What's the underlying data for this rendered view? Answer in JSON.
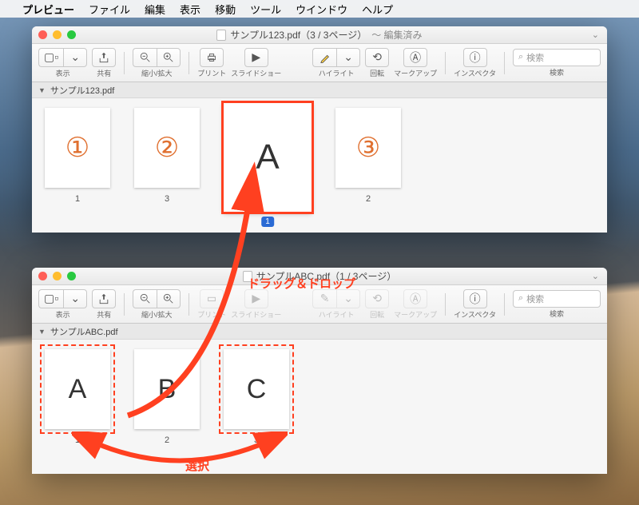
{
  "menubar": {
    "apple": "",
    "app": "プレビュー",
    "items": [
      "ファイル",
      "編集",
      "表示",
      "移動",
      "ツール",
      "ウインドウ",
      "ヘルプ"
    ]
  },
  "window1": {
    "title": "サンプル123.pdf（3 / 3ページ）",
    "status": "〜 編集済み",
    "sidebar": "サンプル123.pdf",
    "thumbs": [
      {
        "glyph": "①",
        "label": "1",
        "kind": "circled"
      },
      {
        "glyph": "②",
        "label": "3",
        "kind": "circled"
      },
      {
        "glyph": "A",
        "label": "",
        "kind": "big",
        "badge": "1"
      },
      {
        "glyph": "③",
        "label": "2",
        "kind": "circled"
      }
    ]
  },
  "window2": {
    "title": "サンプルABC.pdf（1 / 3ページ）",
    "sidebar": "サンプルABC.pdf",
    "thumbs": [
      {
        "glyph": "A",
        "label": "1",
        "kind": "letter",
        "selected": true
      },
      {
        "glyph": "B",
        "label": "2",
        "kind": "letter"
      },
      {
        "glyph": "C",
        "label": "3",
        "kind": "letter",
        "selected": true
      }
    ]
  },
  "toolbar": {
    "view": "表示",
    "share": "共有",
    "zoom": "縮小/拡大",
    "print": "プリント",
    "slideshow": "スライドショー",
    "highlight": "ハイライト",
    "rotate": "回転",
    "markup": "マークアップ",
    "inspector": "インスペクタ",
    "search_ph": "検索",
    "search_lbl": "検索"
  },
  "annotations": {
    "drag": "ドラッグ＆ドロップ",
    "select": "選択"
  }
}
